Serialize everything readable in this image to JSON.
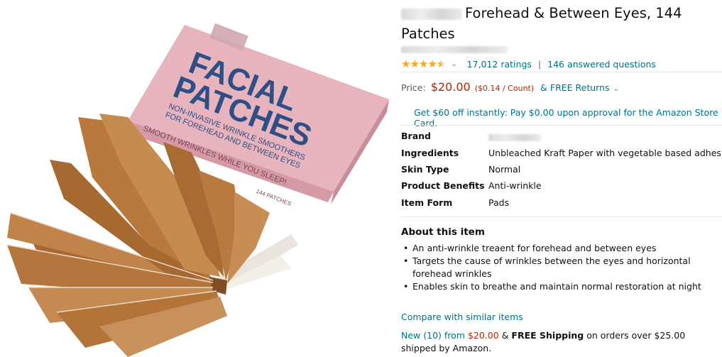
{
  "product": {
    "title": "Forehead & Between Eyes, 144 Patches",
    "rating": {
      "stars": 4.5,
      "ratings_text": "17,012 ratings",
      "answered_text": "146 answered questions"
    },
    "price": {
      "label": "Price:",
      "amount": "$20.00",
      "unit_price": "($0.14 / Count)",
      "returns": "& FREE Returns"
    },
    "store_card_offer": "Get $60 off instantly: Pay $0.00 upon approval for the Amazon Store Card.",
    "specs": [
      {
        "key": "Brand",
        "value": ""
      },
      {
        "key": "Ingredients",
        "value": "Unbleached Kraft Paper with vegetable based adhesive"
      },
      {
        "key": "Skin Type",
        "value": "Normal"
      },
      {
        "key": "Product Benefits",
        "value": "Anti-wrinkle"
      },
      {
        "key": "Item Form",
        "value": "Pads"
      }
    ],
    "about": {
      "heading": "About this item",
      "bullets": [
        "An anti-wrinkle treaent for forehead and between eyes",
        "Targets the cause of wrinkles between the eyes and horizontal forehead wrinkles",
        "Enables skin to breathe and maintain normal restoration at night"
      ]
    },
    "compare_link": "Compare with similar items",
    "new_offer": {
      "link": "New (10) from",
      "price": "$20.00",
      "amp": "&",
      "shipping": "FREE Shipping",
      "rest": "on orders over $25.00 shipped by Amazon."
    }
  },
  "image": {
    "box_line1": "FACIAL",
    "box_line2": "PATCHES",
    "box_sub1": "NON-INVASIVE WRINKLE SMOOTHERS",
    "box_sub2": "FOR FOREHEAD AND BETWEEN EYES",
    "box_tag": "SMOOTH WRINKLES WHILE YOU SLEEP!",
    "box_count": "144 PATCHES",
    "colors": {
      "box": "#e7b3bd",
      "box_text": "#2e4f86",
      "kraft": "#b97a3f"
    }
  }
}
